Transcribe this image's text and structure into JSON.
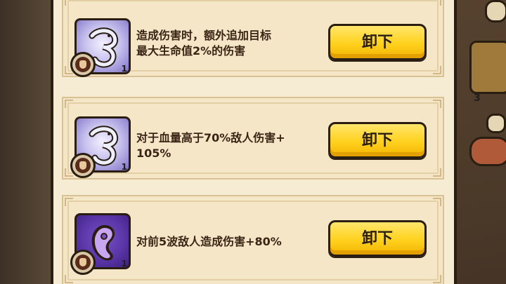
{
  "rune_list": {
    "items": [
      {
        "rune_style": "silver",
        "rune_icon": "silver-serpent-rune-icon",
        "level": "1",
        "description_line1": "造成伤害时，额外追加目标",
        "description_line2": "最大生命值2%的伤害",
        "button_label": "卸下"
      },
      {
        "rune_style": "silver",
        "rune_icon": "silver-serpent-rune-icon",
        "level": "1",
        "description_line1": "对于血量高于70%敌人伤害+",
        "description_line2": "105%",
        "button_label": "卸下"
      },
      {
        "rune_style": "purple",
        "rune_icon": "purple-hook-rune-icon",
        "level": "1",
        "description_line1": "对前5波敌人造成伤害+80%",
        "description_line2": "",
        "button_label": "卸下"
      }
    ]
  },
  "side_panel": {
    "counter": "3"
  },
  "colors": {
    "button_yellow": "#ffd21f",
    "panel_cream": "#f6ecd4",
    "outline": "#2a1d12"
  }
}
